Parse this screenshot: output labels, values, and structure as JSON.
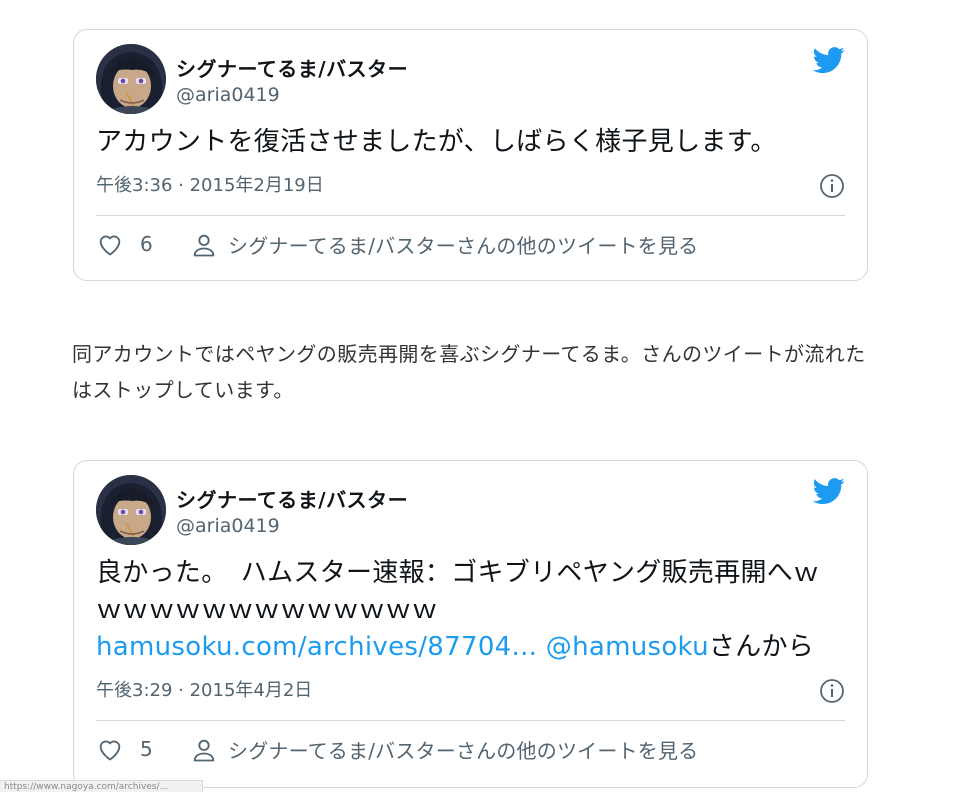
{
  "colors": {
    "link": "#1d9bf0",
    "twitter_brand": "#1d9bf0",
    "muted_text": "#536471",
    "border": "#cfd9de"
  },
  "tweets": [
    {
      "author_name": "シグナーてるま/バスター",
      "author_handle": "@aria0419",
      "text": "アカウントを復活させましたが、しばらく様子見します。",
      "timestamp": "午後3:36 · 2015年2月19日",
      "like_count": "6",
      "more_label": "シグナーてるま/バスターさんの他のツイートを見る",
      "icons": [
        "avatar",
        "twitter-bird-icon",
        "info-icon",
        "heart-icon",
        "person-icon"
      ]
    },
    {
      "author_name": "シグナーてるま/バスター",
      "author_handle": "@aria0419",
      "text": "良かった。　ハムスター速報：ゴキブリペヤング販売再開へｗｗｗｗｗｗｗｗｗｗｗｗｗｗ",
      "link_url": "hamusoku.com/archives/87704...",
      "mention": "@hamusoku",
      "text_suffix": "さんから",
      "timestamp": "午後3:29 · 2015年4月2日",
      "like_count": "5",
      "more_label": "シグナーてるま/バスターさんの他のツイートを見る",
      "icons": [
        "avatar",
        "twitter-bird-icon",
        "info-icon",
        "heart-icon",
        "person-icon"
      ]
    }
  ],
  "article": {
    "paragraph_line1": "同アカウントではペヤングの販売再開を喜ぶシグナーてるま。さんのツイートが流れた",
    "paragraph_line2": "はストップしています。"
  },
  "status_bar": {
    "url": "https://www.nagoya.com/archives/..."
  }
}
